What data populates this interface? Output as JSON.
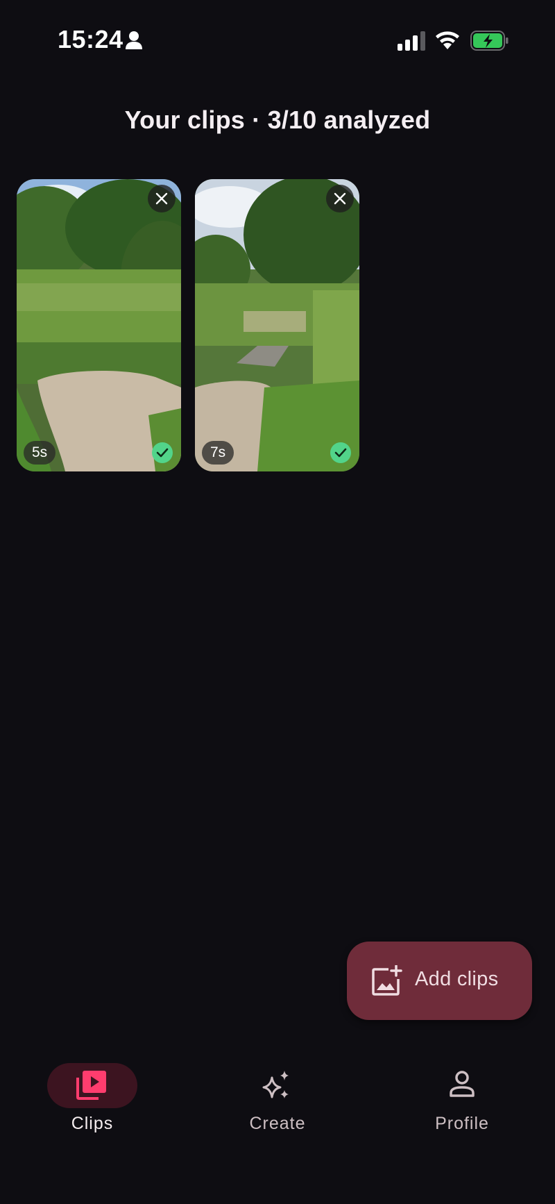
{
  "status_bar": {
    "time": "15:24",
    "icons": [
      "person-icon",
      "cellular-signal-icon",
      "wifi-icon",
      "battery-charging-icon"
    ]
  },
  "page": {
    "title": "Your clips · 3/10 analyzed"
  },
  "clips": [
    {
      "duration": "5s",
      "status": "analyzed",
      "icons": [
        "close-icon",
        "check-icon"
      ]
    },
    {
      "duration": "7s",
      "status": "analyzed",
      "icons": [
        "close-icon",
        "check-icon"
      ]
    }
  ],
  "fab": {
    "label": "Add clips",
    "icon": "add-photo-icon",
    "color": "#6f2c3a"
  },
  "bottom_nav": {
    "items": [
      {
        "label": "Clips",
        "icon": "video-library-icon",
        "active": true
      },
      {
        "label": "Create",
        "icon": "sparkles-icon",
        "active": false
      },
      {
        "label": "Profile",
        "icon": "person-outline-icon",
        "active": false
      }
    ],
    "active_color": "#ff3d6e"
  },
  "colors": {
    "background": "#0e0d12",
    "check": "#52d48a",
    "battery": "#35c759"
  }
}
